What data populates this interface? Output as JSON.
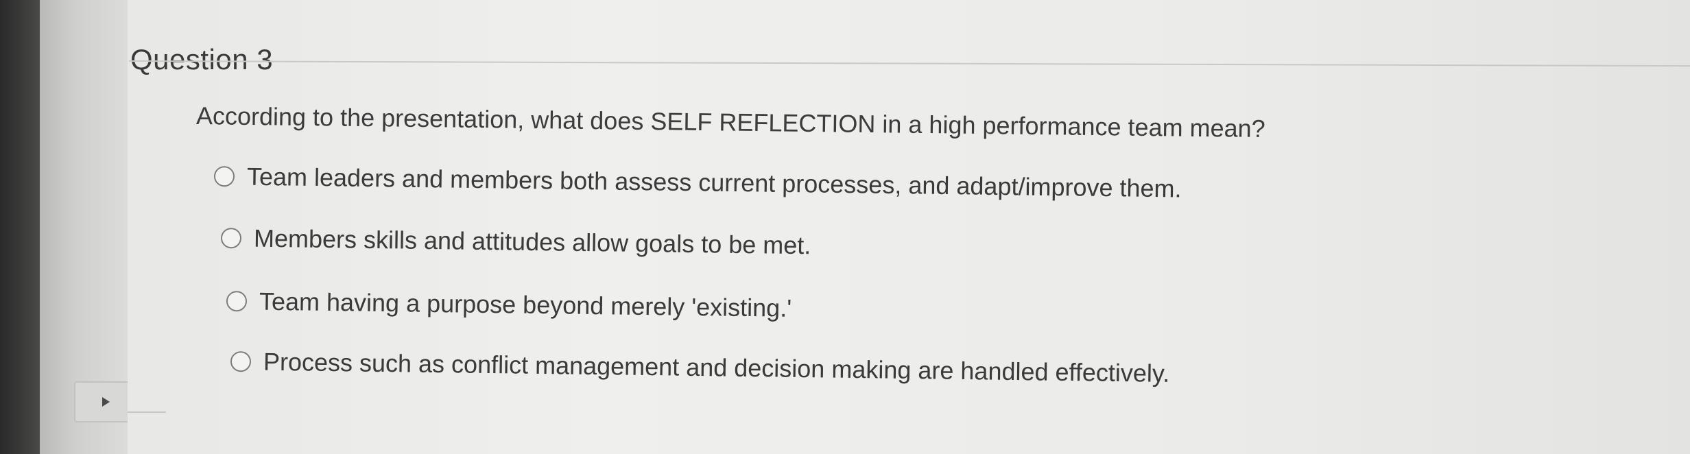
{
  "question": {
    "title": "Question 3",
    "prompt": "According to the presentation, what does SELF REFLECTION in a high performance team mean?",
    "options": [
      {
        "label": "Team leaders and members both assess current processes, and adapt/improve them."
      },
      {
        "label": "Members skills and attitudes allow goals to be met."
      },
      {
        "label": "Team having a purpose beyond merely 'existing.'"
      },
      {
        "label": "Process such as conflict management and decision making are handled effectively."
      }
    ]
  },
  "icons": {
    "radio": "radio-unselected-icon",
    "toggle": "play-triangle-icon"
  },
  "colors": {
    "text": "#3a3a3a",
    "page_background": "#ebebe9",
    "bezel": "#2a2a2a"
  }
}
